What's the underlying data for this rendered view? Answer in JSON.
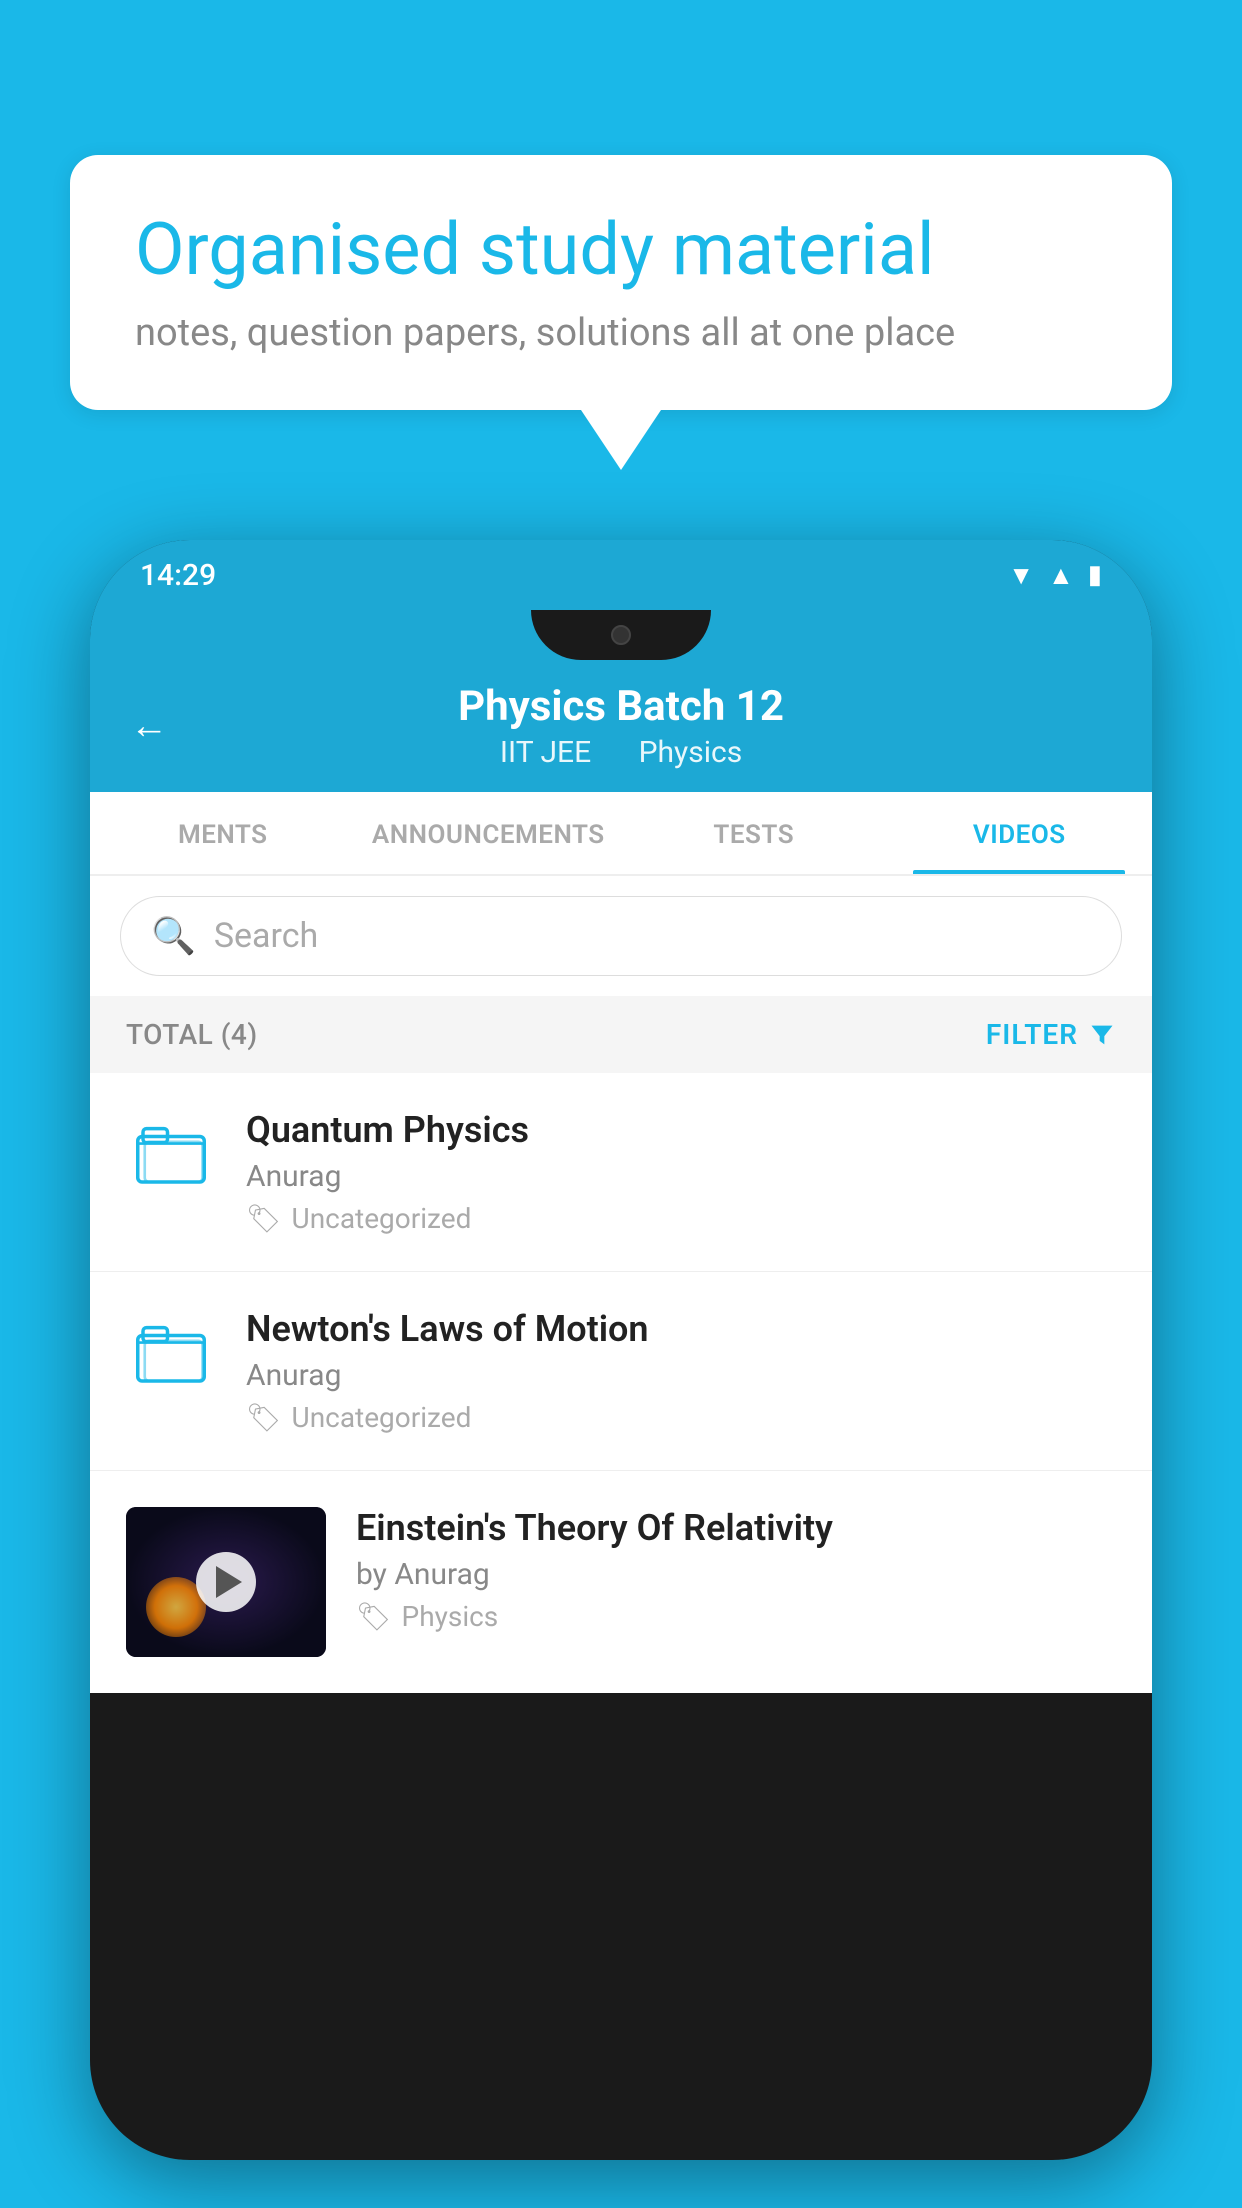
{
  "background_color": "#1ab8e8",
  "speech_bubble": {
    "title": "Organised study material",
    "subtitle": "notes, question papers, solutions all at one place"
  },
  "status_bar": {
    "time": "14:29"
  },
  "header": {
    "back_label": "←",
    "title": "Physics Batch 12",
    "subtitle_1": "IIT JEE",
    "subtitle_2": "Physics"
  },
  "tabs": [
    {
      "label": "MENTS",
      "active": false
    },
    {
      "label": "ANNOUNCEMENTS",
      "active": false
    },
    {
      "label": "TESTS",
      "active": false
    },
    {
      "label": "VIDEOS",
      "active": true
    }
  ],
  "search": {
    "placeholder": "Search"
  },
  "filter_row": {
    "total_label": "TOTAL (4)",
    "filter_label": "FILTER"
  },
  "videos": [
    {
      "title": "Quantum Physics",
      "author": "Anurag",
      "tag": "Uncategorized",
      "has_thumb": false
    },
    {
      "title": "Newton's Laws of Motion",
      "author": "Anurag",
      "tag": "Uncategorized",
      "has_thumb": false
    },
    {
      "title": "Einstein's Theory Of Relativity",
      "author": "by Anurag",
      "tag": "Physics",
      "has_thumb": true
    }
  ]
}
